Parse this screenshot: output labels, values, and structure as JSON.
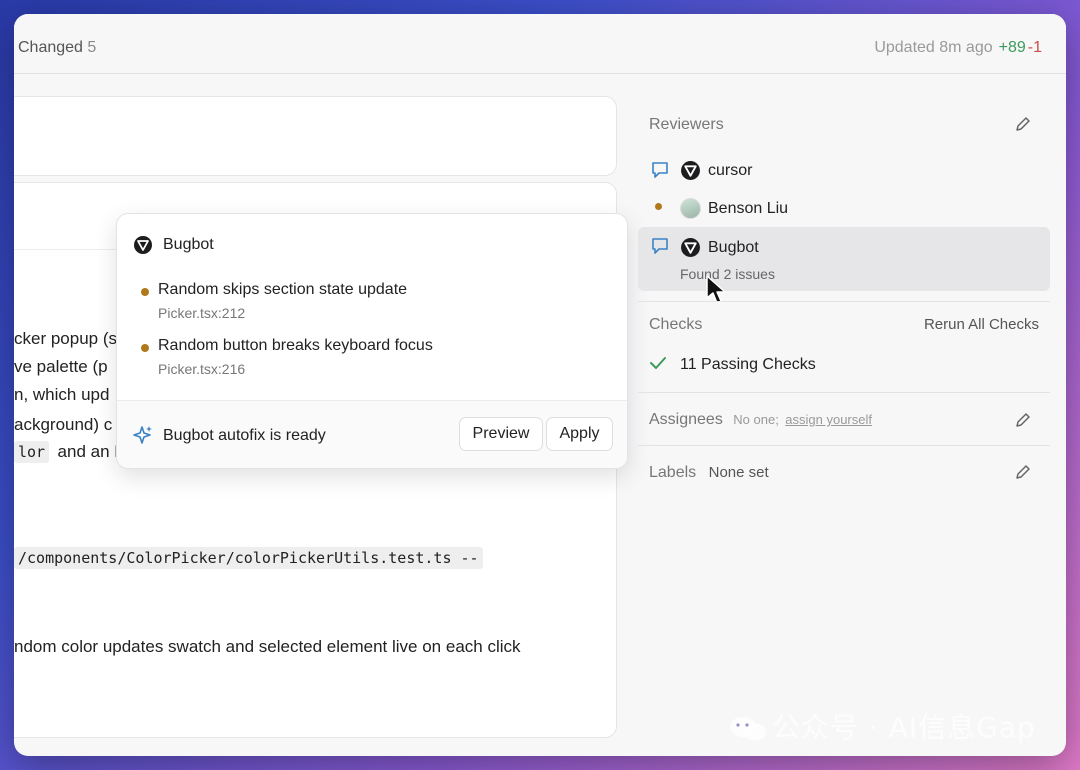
{
  "header": {
    "changed_label": "Changed",
    "changed_count": "5",
    "updated": "Updated 8m ago",
    "additions": "+89",
    "deletions": "-1"
  },
  "content": {
    "lines": [
      "cker popup (s",
      "ve palette (p",
      "n, which upd",
      "ackground) c",
      "and an E"
    ],
    "code_inline": "lor",
    "code_cmd": "/components/ColorPicker/colorPickerUtils.test.ts --",
    "test_line": "ndom color updates swatch and selected element live on each click"
  },
  "popup": {
    "title": "Bugbot",
    "issues": [
      {
        "title": "Random skips section state update",
        "file": "Picker.tsx:212"
      },
      {
        "title": "Random button breaks keyboard focus",
        "file": "Picker.tsx:216"
      }
    ],
    "autofix": "Bugbot autofix is ready",
    "preview_label": "Preview",
    "apply_label": "Apply"
  },
  "sidebar": {
    "reviewers_label": "Reviewers",
    "reviewers": [
      {
        "name": "cursor"
      },
      {
        "name": "Benson Liu"
      },
      {
        "name": "Bugbot",
        "sub": "Found 2 issues"
      }
    ],
    "checks_label": "Checks",
    "rerun_label": "Rerun All Checks",
    "passing": "11 Passing Checks",
    "assignees_label": "Assignees",
    "assignees_none": "No one;",
    "assign_yourself": "assign yourself",
    "labels_label": "Labels",
    "labels_value": "None set"
  },
  "watermark": "公众号 · AI信息Gap",
  "colors": {
    "accent_green": "#3d9a5a",
    "accent_red": "#cc4b4b",
    "issue_dot": "#b07a1c",
    "comment_icon": "#3b82c4"
  }
}
